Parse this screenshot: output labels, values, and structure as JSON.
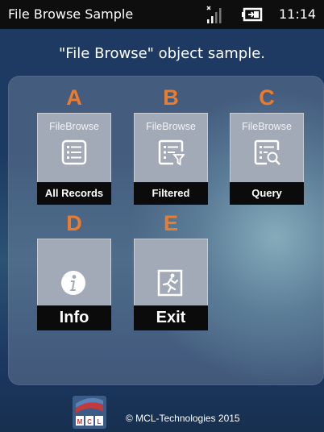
{
  "statusbar": {
    "title": "File Browse Sample",
    "time": "11:14",
    "icons": {
      "signal": "signal-bars-icon",
      "battery": "battery-charging-icon"
    }
  },
  "subtitle": "\"File Browse\" object sample.",
  "tiles": [
    {
      "letter": "A",
      "caption": "FileBrowse",
      "label": "All Records",
      "icon": "list-icon"
    },
    {
      "letter": "B",
      "caption": "FileBrowse",
      "label": "Filtered",
      "icon": "filter-list-icon"
    },
    {
      "letter": "C",
      "caption": "FileBrowse",
      "label": "Query",
      "icon": "search-list-icon"
    },
    {
      "letter": "D",
      "label": "Info",
      "icon": "info-icon"
    },
    {
      "letter": "E",
      "label": "Exit",
      "icon": "exit-icon"
    }
  ],
  "footer": {
    "logo_text": "MCL",
    "copyright": "© MCL-Technologies 2015"
  },
  "colors": {
    "accent_letter": "#ee7b2a",
    "tile": "#a2a9b7",
    "label_bar": "#0b0b0b"
  }
}
